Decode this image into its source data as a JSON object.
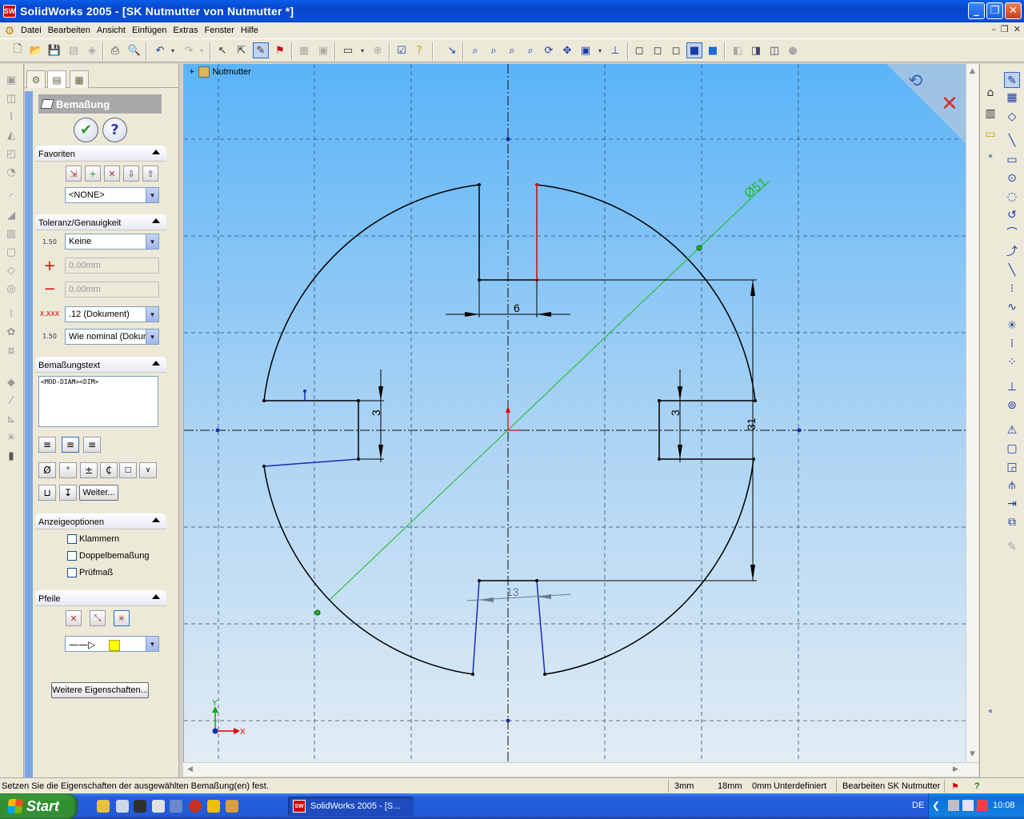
{
  "window": {
    "title": "SolidWorks 2005 - [SK Nutmutter von Nutmutter *]",
    "app_icon_label": "SW"
  },
  "menu": [
    "Datei",
    "Bearbeiten",
    "Ansicht",
    "Einfügen",
    "Extras",
    "Fenster",
    "Hilfe"
  ],
  "property_manager": {
    "title": "Bemaßung",
    "favoriten": {
      "label": "Favoriten",
      "selected": "<NONE>"
    },
    "toleranz": {
      "label": "Toleranz/Genauigkeit",
      "type": "Keine",
      "upper": "0.00mm",
      "lower": "0.00mm",
      "precision": ".12 (Dokument)",
      "tolerance_precision": "Wie nominal (Dokum",
      "tol_icon_text": "1.50",
      "prec_icon_text": "X.XXX"
    },
    "text": {
      "label": "Bemaßungstext",
      "content": "<MOD-DIAM><DIM>",
      "more_button": "Weiter..."
    },
    "anzeige": {
      "label": "Anzeigeoptionen",
      "options": [
        "Klammern",
        "Doppelbemaßung",
        "Prüfmaß"
      ]
    },
    "pfeile": {
      "label": "Pfeile"
    },
    "more_props_button": "Weitere Eigenschaften..."
  },
  "graphics": {
    "tree_root": "Nutmutter",
    "dimensions": {
      "diameter": "Ø51",
      "slot_top": "6",
      "slot_bottom": "13",
      "slot_left": "3",
      "slot_right": "3",
      "depth": "31"
    },
    "axis_x": "X",
    "axis_y": "Y"
  },
  "status": {
    "message": "Setzen Sie die Eigenschaften der ausgewählten Bemaßung(en) fest.",
    "x": "3mm",
    "y": "18mm",
    "z": "0mm",
    "state": "Unterdefiniert",
    "mode": "Bearbeiten SK Nutmutter"
  },
  "taskbar": {
    "start": "Start",
    "task": "SolidWorks 2005 - [S...",
    "task_icon": "SW",
    "lang": "DE",
    "clock": "10:08"
  }
}
